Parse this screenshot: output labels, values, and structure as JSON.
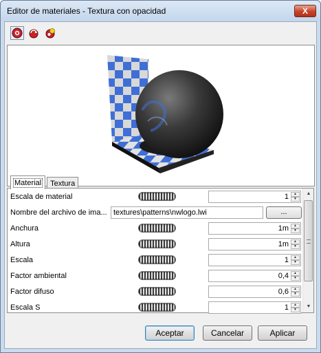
{
  "window": {
    "title": "Editor de materiales - Textura con opacidad",
    "close_glyph": "X"
  },
  "toolbar": {
    "icons": [
      "sphere-render-icon",
      "refresh-render-icon",
      "light-render-icon"
    ]
  },
  "tabs": [
    {
      "label": "Material",
      "active": true
    },
    {
      "label": "Textura",
      "active": false
    }
  ],
  "properties": {
    "material_scale": {
      "label": "Escala de material",
      "value": "1"
    },
    "image_file": {
      "label": "Nombre del archivo de ima...",
      "value": "textures\\patterns\\nwlogo.lwi",
      "browse": "..."
    },
    "width": {
      "label": "Anchura",
      "value": "1m"
    },
    "height": {
      "label": "Altura",
      "value": "1m"
    },
    "scale": {
      "label": "Escala",
      "value": "1"
    },
    "ambient": {
      "label": "Factor ambiental",
      "value": "0,4"
    },
    "diffuse": {
      "label": "Factor difuso",
      "value": "0,6"
    },
    "scale_s": {
      "label": "Escala S",
      "value": "1"
    }
  },
  "buttons": {
    "accept": "Aceptar",
    "cancel": "Cancelar",
    "apply": "Aplicar"
  },
  "colors": {
    "titlebar": "#c9dbee",
    "checker_blue": "#3f6fd6",
    "checker_light": "#d4d4d4"
  }
}
